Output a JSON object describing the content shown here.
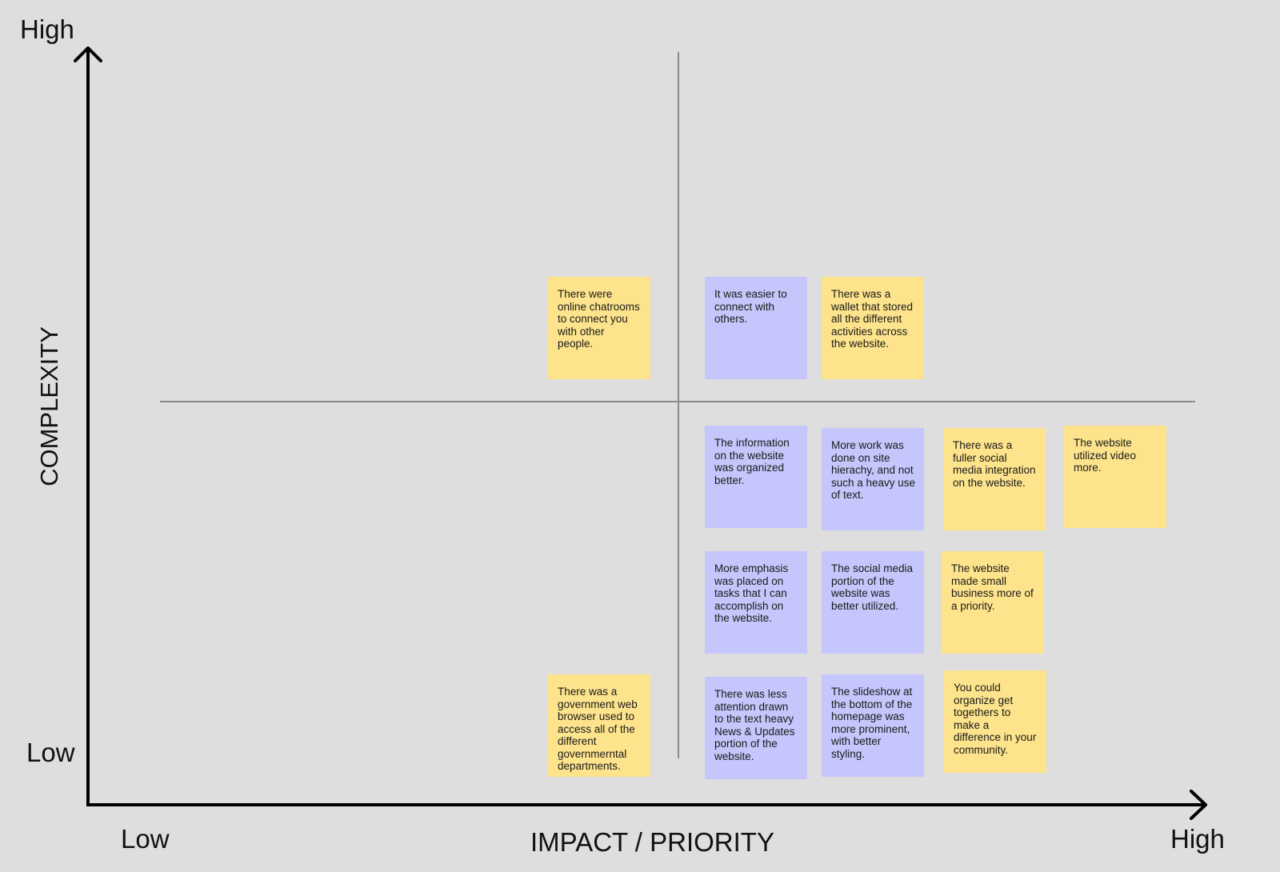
{
  "diagram": {
    "type": "2x2 prioritization matrix",
    "x_axis": {
      "title": "IMPACT / PRIORITY",
      "low_label": "Low",
      "high_label": "High"
    },
    "y_axis": {
      "title": "COMPLEXITY",
      "low_label": "Low",
      "high_label": "High"
    },
    "colors": {
      "background": "#dedede",
      "yellow_note": "#fde48c",
      "purple_note": "#c5c6fb",
      "axis": "#000000",
      "divider": "#8a8a8a"
    },
    "notes": [
      {
        "text": "There were online chatrooms to connect you with other people.",
        "color": "yellow",
        "quadrant": "top-left"
      },
      {
        "text": "It was easier to connect with others.",
        "color": "purple",
        "quadrant": "top-right"
      },
      {
        "text": "There was a wallet that stored all the different activities across the website.",
        "color": "yellow",
        "quadrant": "top-right"
      },
      {
        "text": "The information on the website was organized better.",
        "color": "purple",
        "quadrant": "bottom-right"
      },
      {
        "text": "More work was done on site hierachy, and not such a heavy use of text.",
        "color": "purple",
        "quadrant": "bottom-right"
      },
      {
        "text": "There was a fuller social media integration on the website.",
        "color": "yellow",
        "quadrant": "bottom-right"
      },
      {
        "text": "The website utilized video more.",
        "color": "yellow",
        "quadrant": "bottom-right"
      },
      {
        "text": "More emphasis was placed on tasks that I can accomplish on the website.",
        "color": "purple",
        "quadrant": "bottom-right"
      },
      {
        "text": "The social media portion of the website was better utilized.",
        "color": "purple",
        "quadrant": "bottom-right"
      },
      {
        "text": "The website made small business more of a priority.",
        "color": "yellow",
        "quadrant": "bottom-right"
      },
      {
        "text": "There was a government web browser used to access all of the different governmerntal departments.",
        "color": "yellow",
        "quadrant": "bottom-left"
      },
      {
        "text": "There was less attention drawn to the text heavy News & Updates portion of the website.",
        "color": "purple",
        "quadrant": "bottom-right"
      },
      {
        "text": "The slideshow at the bottom of the homepage was more prominent, with better styling.",
        "color": "purple",
        "quadrant": "bottom-right"
      },
      {
        "text": "You could organize get togethers to make a difference in your community.",
        "color": "yellow",
        "quadrant": "bottom-right"
      }
    ]
  }
}
